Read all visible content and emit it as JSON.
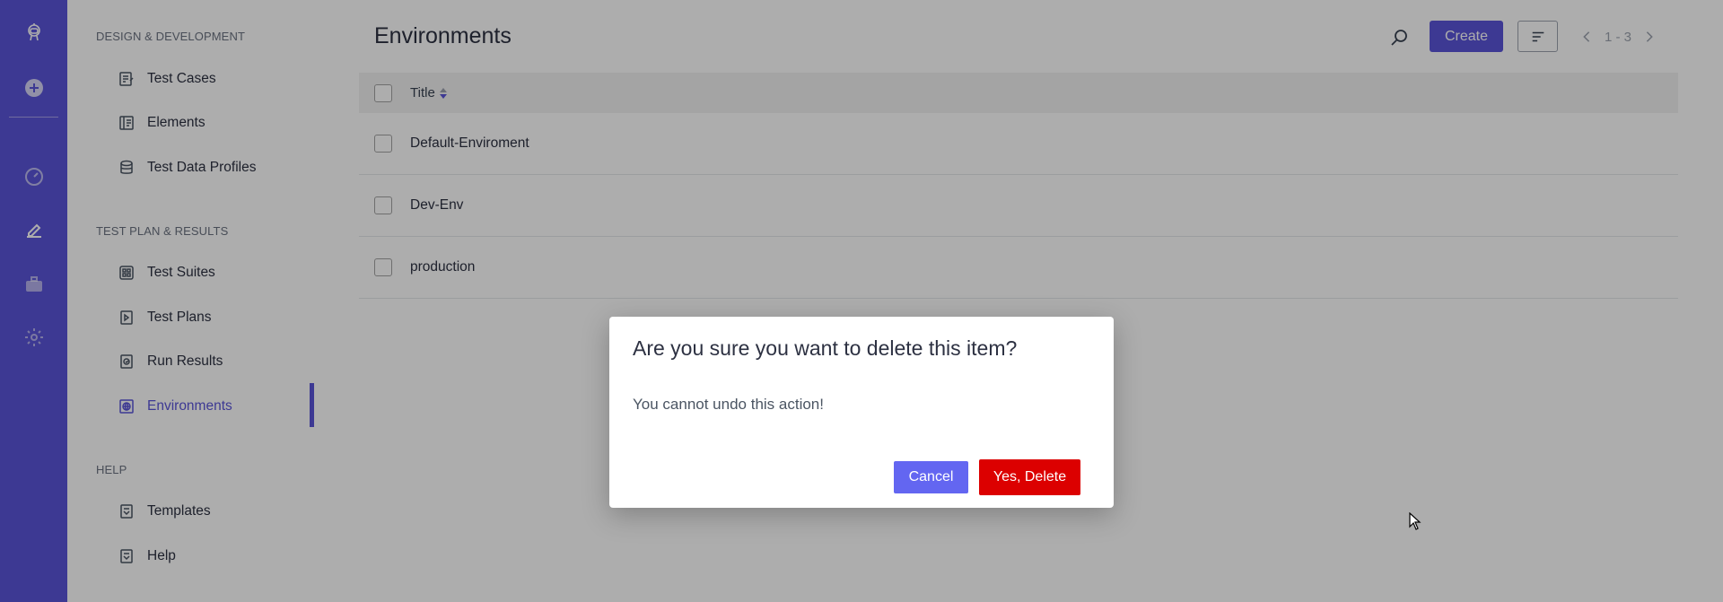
{
  "rail": {
    "icons": [
      "robot-logo-icon",
      "add-circle-icon",
      "dashboard-gauge-icon",
      "pencil-icon",
      "briefcase-icon",
      "settings-gear-icon"
    ]
  },
  "nav": {
    "sections": [
      {
        "heading": "DESIGN & DEVELOPMENT",
        "items": [
          {
            "label": "Test Cases",
            "icon": "test-cases-icon"
          },
          {
            "label": "Elements",
            "icon": "elements-icon"
          },
          {
            "label": "Test Data Profiles",
            "icon": "database-icon"
          }
        ]
      },
      {
        "heading": "TEST PLAN & RESULTS",
        "items": [
          {
            "label": "Test Suites",
            "icon": "test-suites-icon"
          },
          {
            "label": "Test Plans",
            "icon": "test-plans-icon"
          },
          {
            "label": "Run Results",
            "icon": "run-results-icon"
          },
          {
            "label": "Environments",
            "icon": "globe-icon",
            "active": true
          }
        ]
      },
      {
        "heading": "HELP",
        "items": [
          {
            "label": "Templates",
            "icon": "templates-icon"
          },
          {
            "label": "Help",
            "icon": "help-icon"
          }
        ]
      }
    ]
  },
  "header": {
    "title": "Environments",
    "create_label": "Create",
    "pagination": "1 - 3"
  },
  "table": {
    "column_title": "Title",
    "rows": [
      "Default-Enviroment",
      "Dev-Env",
      "production"
    ]
  },
  "modal": {
    "title": "Are you sure you want to delete this item?",
    "body": "You cannot undo this action!",
    "cancel_label": "Cancel",
    "confirm_label": "Yes, Delete"
  },
  "colors": {
    "brand": "#5b55d9",
    "cancel": "#6366f1",
    "danger": "#dc0000"
  }
}
